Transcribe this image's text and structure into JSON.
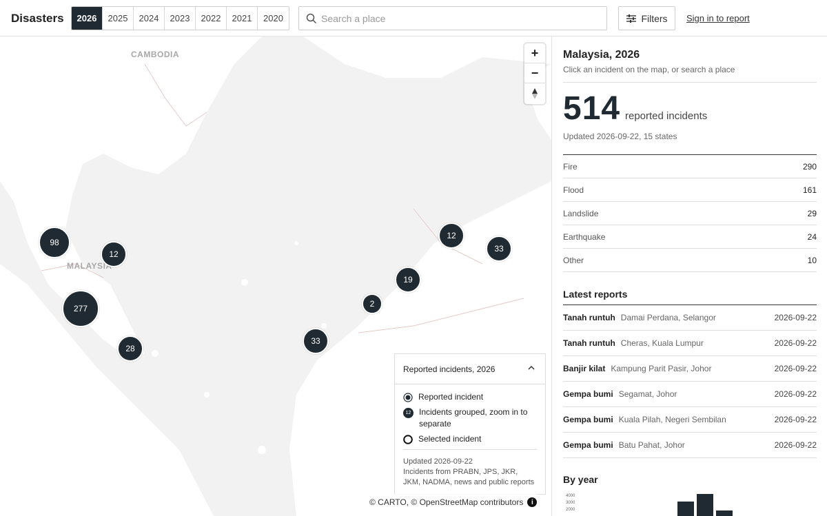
{
  "header": {
    "brand": "Disasters",
    "years": [
      "2026",
      "2025",
      "2024",
      "2023",
      "2022",
      "2021",
      "2020"
    ],
    "active_year": "2026",
    "search_placeholder": "Search a place",
    "filters_label": "Filters",
    "signin_label": "Sign in to report"
  },
  "map": {
    "labels": {
      "country_a": "CAMBODIA",
      "country_b": "MALAYSIA"
    },
    "clusters": [
      "98",
      "12",
      "277",
      "28",
      "33",
      "2",
      "19",
      "12",
      "33"
    ],
    "zoom": {
      "in": "+",
      "out": "−"
    },
    "legend": {
      "title": "Reported incidents, 2026",
      "items": [
        "Reported incident",
        "Incidents grouped, zoom in to separate",
        "Selected incident"
      ],
      "group_badge": "12",
      "updated": "Updated 2026-09-22",
      "sources": "Incidents from PRABN, JPS, JKR, JKM, NADMA, news and public reports"
    },
    "attribution": "© CARTO, © OpenStreetMap contributors",
    "info_icon": "i"
  },
  "sidebar": {
    "title": "Malaysia, 2026",
    "subtitle": "Click an incident on the map, or search a place",
    "total": "514",
    "total_label": "reported incidents",
    "updated": "Updated 2026-09-22, 15 states",
    "categories": [
      {
        "name": "Fire",
        "value": "290"
      },
      {
        "name": "Flood",
        "value": "161"
      },
      {
        "name": "Landslide",
        "value": "29"
      },
      {
        "name": "Earthquake",
        "value": "24"
      },
      {
        "name": "Other",
        "value": "10"
      }
    ],
    "latest_title": "Latest reports",
    "reports": [
      {
        "type": "Tanah runtuh",
        "place": "Damai Perdana, Selangor",
        "date": "2026-09-22"
      },
      {
        "type": "Tanah runtuh",
        "place": "Cheras, Kuala Lumpur",
        "date": "2026-09-22"
      },
      {
        "type": "Banjir kilat",
        "place": "Kampung Parit Pasir, Johor",
        "date": "2026-09-22"
      },
      {
        "type": "Gempa bumi",
        "place": "Segamat, Johor",
        "date": "2026-09-22"
      },
      {
        "type": "Gempa bumi",
        "place": "Kuala Pilah, Negeri Sembilan",
        "date": "2026-09-22"
      },
      {
        "type": "Gempa bumi",
        "place": "Batu Pahat, Johor",
        "date": "2026-09-22"
      }
    ],
    "by_year_title": "By year",
    "by_year_ticks": [
      "4000",
      "3000",
      "2000"
    ]
  },
  "colors": {
    "accent": "#1f2a32",
    "land": "#ffffff",
    "water": "#f2f2f3"
  }
}
